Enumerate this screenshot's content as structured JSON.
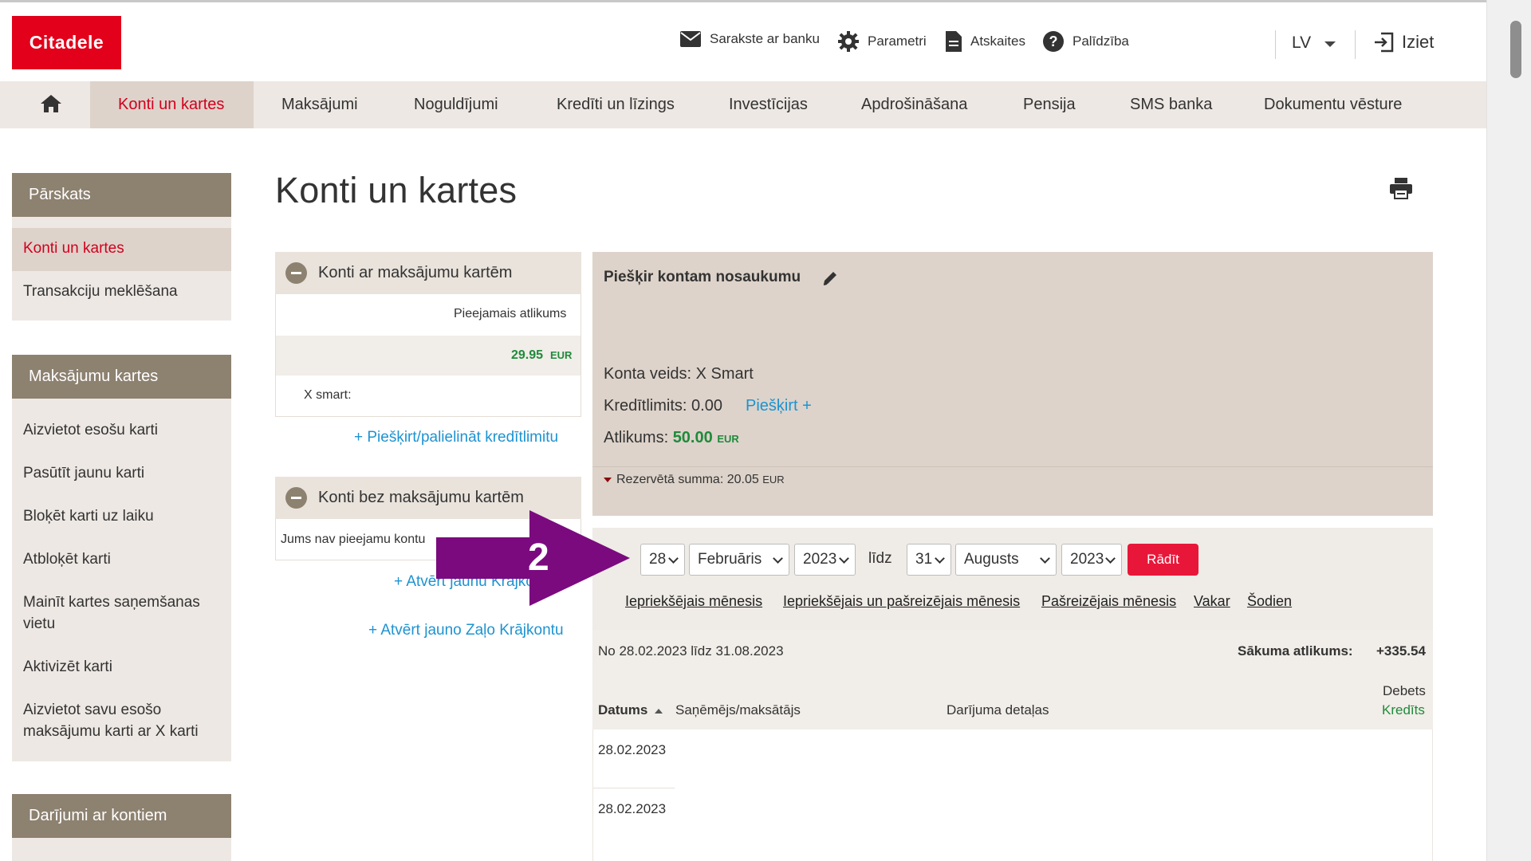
{
  "header": {
    "logo": "Citadele",
    "utility": [
      {
        "label": "Sarakste ar banku",
        "icon": "envelope-icon"
      },
      {
        "label": "Parametri",
        "icon": "gear-icon"
      },
      {
        "label": "Atskaites",
        "icon": "document-icon"
      },
      {
        "label": "Palīdzība",
        "icon": "help-icon"
      }
    ],
    "language": "LV",
    "logout": "Iziet"
  },
  "nav": {
    "home_icon": "home-icon",
    "items": [
      "Konti un kartes",
      "Maksājumi",
      "Noguldījumi",
      "Kredīti un līzings",
      "Investīcijas",
      "Apdrošināšana",
      "Pensija",
      "SMS banka",
      "Dokumentu vēsture"
    ]
  },
  "sidebar": {
    "section1": {
      "title": "Pārskats",
      "items": [
        "Konti un kartes",
        "Transakciju meklēšana"
      ]
    },
    "section2": {
      "title": "Maksājumu kartes",
      "items": [
        "Aizvietot esošu karti",
        "Pasūtīt jaunu karti",
        "Bloķēt karti uz laiku",
        "Atbloķēt karti",
        "Mainīt kartes saņemšanas vietu",
        "Aktivizēt karti",
        "Aizvietot savu esošo maksājumu karti ar X karti"
      ]
    },
    "section3": {
      "title": "Darījumi ar kontiem"
    }
  },
  "main": {
    "title": "Konti un kartes",
    "print_icon": "printer-icon"
  },
  "accounts_with_cards": {
    "title": "Konti ar maksājumu kartēm",
    "available_label": "Pieejamais atlikums",
    "amount": "29.95",
    "currency": "EUR",
    "account_name": "X smart:",
    "credit_link": "+ Piešķirt/palielināt kredītlimitu"
  },
  "accounts_without_cards": {
    "title": "Konti bez maksājumu kartēm",
    "empty_text": "Jums nav pieejamu kontu",
    "open_link": "+ Atvērt jaunu Krājkontu",
    "open_green_link": "+ Atvērt jauno Zaļo Krājkontu"
  },
  "account_detail": {
    "name_prompt": "Piešķir kontam nosaukumu",
    "edit_icon": "pencil-icon",
    "type": "Konta veids: X Smart",
    "credit_limit": "Kredītlimits: 0.00",
    "assign_link": "Piešķirt +",
    "balance_label": "Atlikums:",
    "balance_value": "50.00",
    "balance_currency": "EUR",
    "reserved": "Rezervētā summa: 20.05",
    "reserved_currency": "EUR"
  },
  "filter": {
    "from_day": "28",
    "from_month": "Februāris",
    "from_year": "2023",
    "until_label": "līdz",
    "to_day": "31",
    "to_month": "Augusts",
    "to_year": "2023",
    "show_button": "Rādīt",
    "quick_links": [
      "Iepriekšējais mēnesis",
      "Iepriekšējais un pašreizējais mēnesis",
      "Pašreizējais mēnesis",
      "Vakar",
      "Šodien"
    ]
  },
  "results": {
    "period": "No 28.02.2023 līdz 31.08.2023",
    "start_balance_label": "Sākuma atlikums:",
    "start_balance_value": "+335.54",
    "columns": {
      "date": "Datums",
      "payee": "Saņēmējs/maksātājs",
      "details": "Darījuma detaļas",
      "debit": "Debets",
      "credit": "Kredīts"
    },
    "rows": [
      {
        "date": "28.02.2023"
      },
      {
        "date": "28.02.2023"
      }
    ]
  },
  "overlay": {
    "step_number": "2",
    "arrow_color": "#7b0a7f"
  }
}
